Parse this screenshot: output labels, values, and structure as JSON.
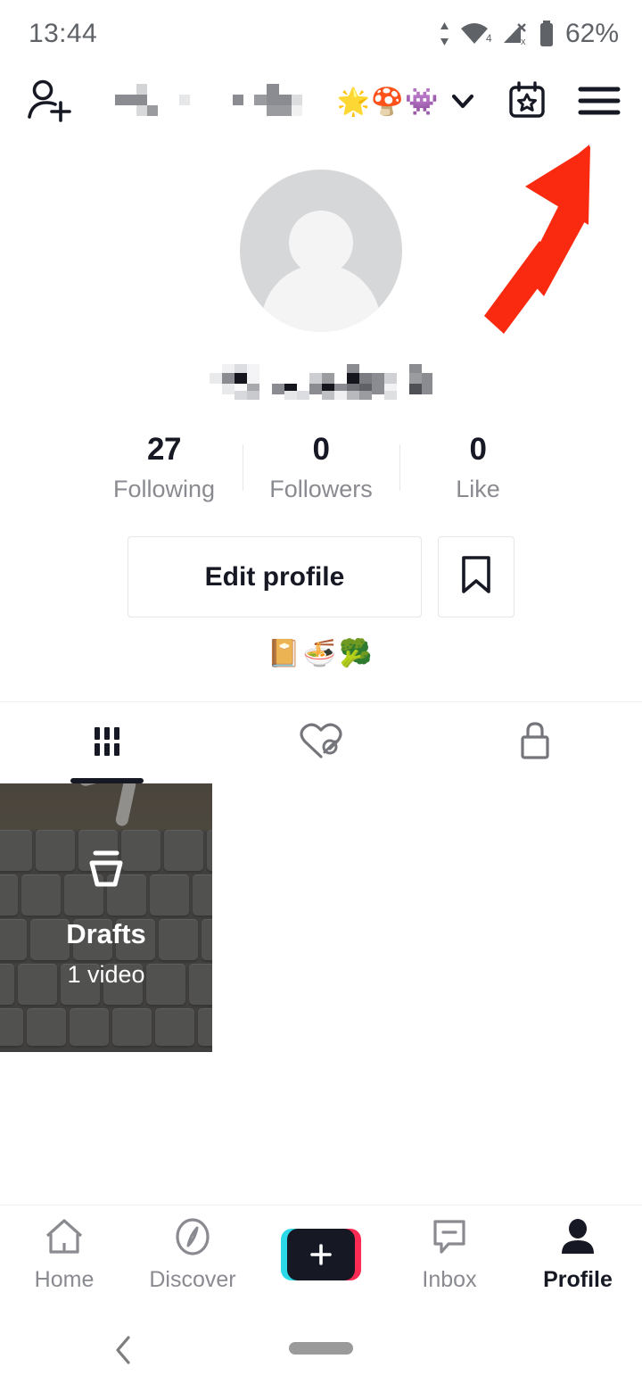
{
  "status_bar": {
    "time": "13:44",
    "battery_percent": "62%",
    "icons": [
      "data-transfer-arrows-icon",
      "wifi-icon",
      "cellular-signal-off-icon",
      "battery-icon"
    ],
    "wifi_badge": "4",
    "cellular_badge": "x",
    "text_color": "#5f6368"
  },
  "top_nav": {
    "add_friends_icon": "add-person-icon",
    "username_censored": true,
    "title_emojis": "🌟🍄👾",
    "dropdown_icon": "chevron-down-icon",
    "calendar_icon": "calendar-star-icon",
    "menu_icon": "hamburger-menu-icon"
  },
  "annotation": {
    "type": "arrow",
    "color": "#f92a10",
    "points_to": "hamburger-menu-icon",
    "direction": "up-right"
  },
  "profile": {
    "avatar_icon": "default-avatar-placeholder",
    "username_censored": true,
    "stats": [
      {
        "count": "27",
        "label": "Following"
      },
      {
        "count": "0",
        "label": "Followers"
      },
      {
        "count": "0",
        "label": "Like"
      }
    ],
    "edit_profile_label": "Edit profile",
    "bookmark_icon": "bookmark-icon",
    "bio": "📔🍜🥦"
  },
  "content_tabs": [
    {
      "icon": "grid-videos-icon",
      "active": true
    },
    {
      "icon": "liked-hidden-heart-icon",
      "active": false
    },
    {
      "icon": "private-lock-icon",
      "active": false
    }
  ],
  "grid": {
    "drafts": {
      "icon": "drafts-tray-icon",
      "title": "Drafts",
      "subtitle": "1 video"
    }
  },
  "bottom_nav": [
    {
      "label": "Home",
      "icon": "home-icon",
      "active": false
    },
    {
      "label": "Discover",
      "icon": "compass-discover-icon",
      "active": false
    },
    {
      "label": "",
      "icon": "create-plus-button",
      "active": false
    },
    {
      "label": "Inbox",
      "icon": "inbox-message-icon",
      "active": false
    },
    {
      "label": "Profile",
      "icon": "profile-person-icon",
      "active": true
    }
  ],
  "system_nav": {
    "back_icon": "back-chevron-icon",
    "home_pill_icon": "home-gesture-pill"
  },
  "colors": {
    "accent_pink": "#fe2c55",
    "accent_cyan": "#2ad8e8",
    "text_primary": "#161823",
    "text_secondary": "#8a8b91",
    "annotation_red": "#f92a10"
  }
}
